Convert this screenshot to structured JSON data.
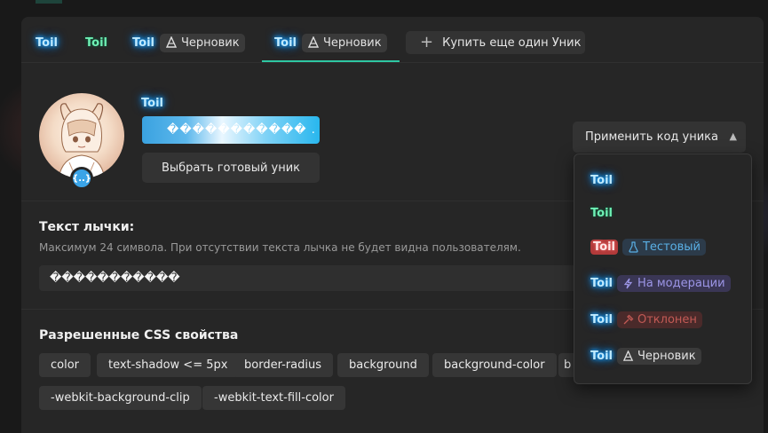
{
  "tabs": [
    {
      "toil": "Toil",
      "style": "blue",
      "chip": null,
      "active": false
    },
    {
      "toil": "Toil",
      "style": "green",
      "chip": null,
      "active": false
    },
    {
      "toil": "Toil",
      "style": "blue",
      "chip": "Черновик",
      "active": false
    },
    {
      "toil": "Toil",
      "style": "blue",
      "chip": "Черновик",
      "active": true
    }
  ],
  "buy_button": {
    "label": "Купить еще один Уник",
    "icon": "plus-icon"
  },
  "profile": {
    "name_preview": "Toil",
    "gradient_value": "�����������  .",
    "choose_button": "Выбрать готовый уник",
    "apply_button": "Применить код уника"
  },
  "badge_text": {
    "title": "Текст лычки:",
    "hint": "Максимум 24 символа. При отсутствии текста лычка не будет видна пользователям.",
    "value": "�����������"
  },
  "css_props": {
    "title": "Разрешенные CSS свойства",
    "items": [
      "color",
      "text-shadow <= 5px",
      "border-radius",
      "background",
      "background-color",
      "b",
      "-webkit-background-clip",
      "-webkit-text-fill-color"
    ]
  },
  "dropdown": {
    "items": [
      {
        "toil": "Toil",
        "style": "blue",
        "status": null
      },
      {
        "toil": "Toil",
        "style": "green",
        "status": null
      },
      {
        "toil": "Toil",
        "style": "red",
        "status": "Тестовый",
        "status_icon": "flask-icon"
      },
      {
        "toil": "Toil",
        "style": "blue",
        "status": "На модерации",
        "status_icon": "lightning-icon"
      },
      {
        "toil": "Toil",
        "style": "blue",
        "status": "Отклонен",
        "status_icon": "hammer-icon"
      },
      {
        "toil": "Toil",
        "style": "blue",
        "status": "Черновик",
        "status_icon": "pen-tool-icon"
      }
    ]
  },
  "colors": {
    "accent": "#2ec7a2",
    "glow_blue": "#18a3ff",
    "panel": "#262626"
  }
}
